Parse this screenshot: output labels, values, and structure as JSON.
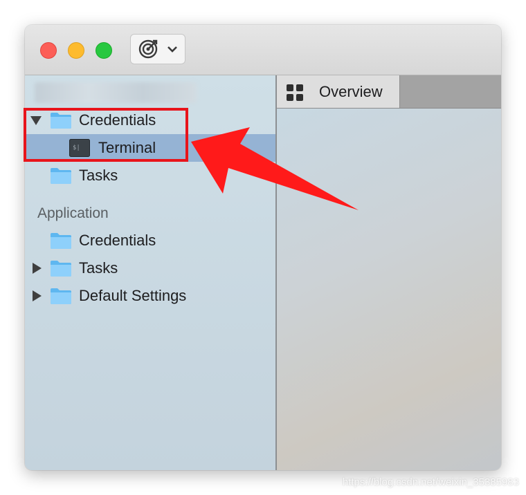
{
  "toolbar": {
    "target_icon": "target-icon",
    "chevron_icon": "chevron-down-icon"
  },
  "sidebar": {
    "top_group": [
      {
        "label": "Credentials",
        "expanded": true
      },
      {
        "label": "Terminal",
        "selected": true,
        "icon": "terminal-icon"
      },
      {
        "label": "Tasks"
      }
    ],
    "section_label": "Application",
    "app_group": [
      {
        "label": "Credentials"
      },
      {
        "label": "Tasks",
        "expandable": true
      },
      {
        "label": "Default Settings",
        "expandable": true
      }
    ]
  },
  "tabs": [
    {
      "label": "Overview",
      "icon": "grid-icon"
    }
  ],
  "annotation": {
    "highlight_color": "#e8141b",
    "arrow_color": "#ff1a1a"
  },
  "watermark": "https://blog.csdn.net/weixin_35385983"
}
